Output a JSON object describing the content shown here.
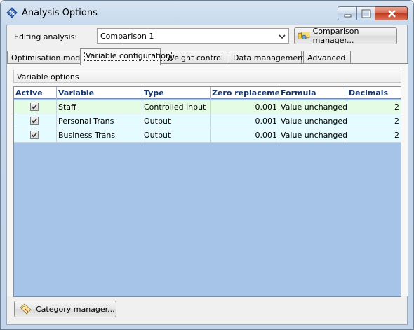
{
  "window": {
    "title": "Analysis Options"
  },
  "editing": {
    "label": "Editing analysis:",
    "selected": "Comparison 1",
    "manager_button": "Comparison manager..."
  },
  "tabs": [
    {
      "label": "Optimisation mode",
      "active": false
    },
    {
      "label": "Variable configuration",
      "active": true
    },
    {
      "label": "Weight control",
      "active": false
    },
    {
      "label": "Data management",
      "active": false
    },
    {
      "label": "Advanced",
      "active": false
    }
  ],
  "variable_options": {
    "header": "Variable options",
    "columns": [
      "Active",
      "Variable",
      "Type",
      "Zero replacement",
      "Formula",
      "Decimals"
    ],
    "rows": [
      {
        "active": true,
        "variable": "Staff",
        "type": "Controlled input",
        "zero": "0.001",
        "formula": "Value unchanged",
        "decimals": "2",
        "bg": "#e4fbe4"
      },
      {
        "active": true,
        "variable": "Personal Trans",
        "type": "Output",
        "zero": "0.001",
        "formula": "Value unchanged",
        "decimals": "2",
        "bg": "#e4fcff"
      },
      {
        "active": true,
        "variable": "Business Trans",
        "type": "Output",
        "zero": "0.001",
        "formula": "Value unchanged",
        "decimals": "2",
        "bg": "#e4fcff"
      }
    ]
  },
  "category_button": "Category manager..."
}
